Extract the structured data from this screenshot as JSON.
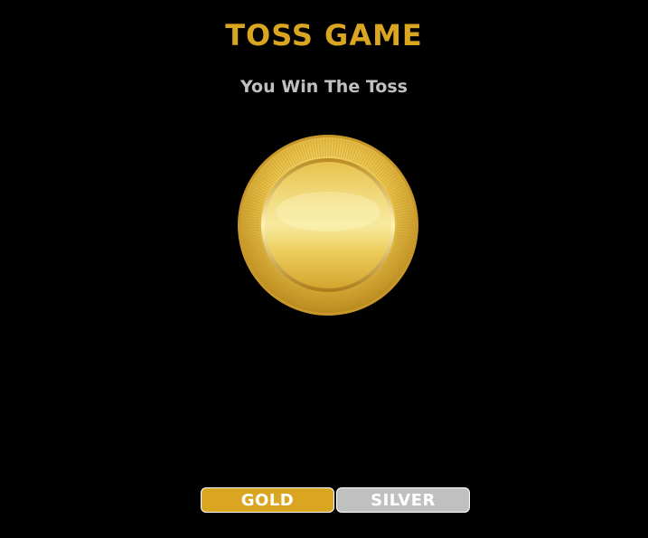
{
  "header": {
    "title": "TOSS GAME"
  },
  "status": {
    "message": "You Win The Toss"
  },
  "coin": {
    "face": "gold",
    "icon": "gold-coin-icon"
  },
  "choices": [
    {
      "label": "GOLD",
      "color": "#DAA520"
    },
    {
      "label": "SILVER",
      "color": "#C0C0C0"
    }
  ],
  "colors": {
    "background": "#000000",
    "title": "#DAA520",
    "status": "#C0C0C0"
  }
}
